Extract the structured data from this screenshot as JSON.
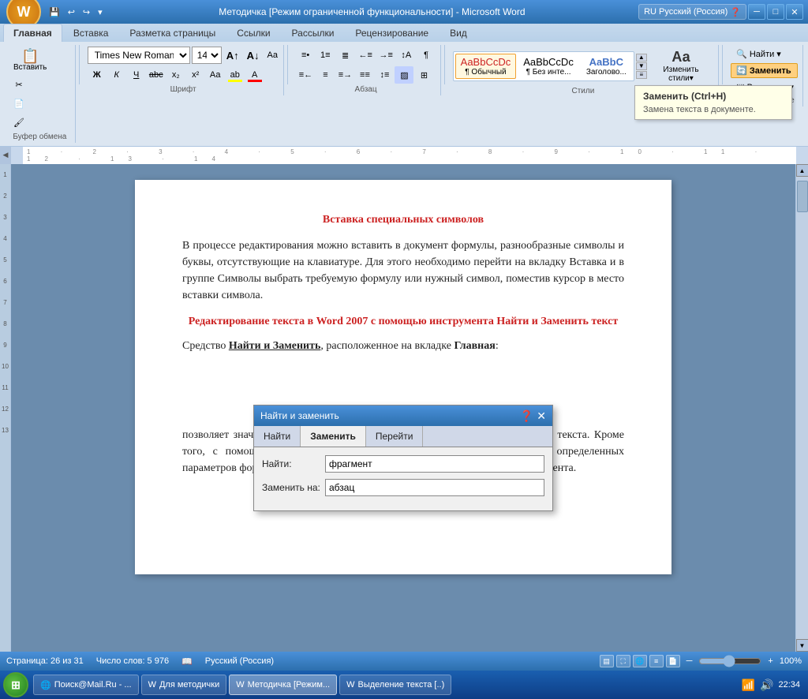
{
  "window": {
    "title": "Методичка [Режим ограниченной функциональности] - Microsoft Word",
    "lang_indicator": "RU Русский (Россия)"
  },
  "ribbon": {
    "tabs": [
      "Главная",
      "Вставка",
      "Разметка страницы",
      "Ссылки",
      "Рассылки",
      "Рецензирование",
      "Вид"
    ],
    "active_tab": "Главная",
    "paste_label": "Вставить",
    "clipboard_label": "Буфер обмена",
    "font_name": "Times New Roman",
    "font_size": "14",
    "font_group_label": "Шрифт",
    "paragraph_group_label": "Абзац",
    "styles_group_label": "Стили",
    "editing_group_label": "Редактирование",
    "find_label": "Найти",
    "replace_label": "Заменить",
    "select_label": "Выделить",
    "change_styles_label": "Изменить стили▾",
    "styles": [
      {
        "name": "Обычный",
        "preview": "AaBbCcDc",
        "active": true
      },
      {
        "name": "¶ Без инте...",
        "preview": "AaBbCcDc",
        "active": false
      },
      {
        "name": "Заголово...",
        "preview": "AaBbC",
        "active": false
      }
    ]
  },
  "document": {
    "title": "Вставка специальных символов",
    "paragraph1": "В процессе редактирования можно вставить в документ формулы, разнообразные символы и буквы, отсутствующие на клавиатуре. Для этого необходимо перейти на вкладку Вставка и в группе Символы выбрать требуемую формулу или нужный символ, поместив курсор в место вставки символа.",
    "heading2": "Редактирование текста в Word 2007 с помощью инструмента Найти и Заменить текст",
    "paragraph2_start": "Средство ",
    "paragraph2_bold": "Найти и Заменить",
    "paragraph2_end": ", расположенное на вкладке ",
    "paragraph2_bold2": "Главная",
    "paragraph2_colon": ":",
    "paragraph3": " позволяет значительно ускорить процесс редактирования (правки) большого текста. Кроме того, с помощью этой команды можно осуществлять поиск и замену определенных параметров форматирования, специальных символов и других объектов документа."
  },
  "tooltip": {
    "title": "Заменить (Ctrl+H)",
    "description": "Замена текста в документе."
  },
  "find_dialog": {
    "title": "Найти и заменить",
    "tabs": [
      "Найти",
      "Заменить",
      "Перейти"
    ],
    "active_tab": "Заменить",
    "find_label": "Найти:",
    "find_value": "фрагмент",
    "replace_label": "Заменить на:",
    "replace_value": "абзац"
  },
  "status_bar": {
    "page_info": "Страница: 26 из 31",
    "word_count": "Число слов: 5 976",
    "language": "Русский (Россия)",
    "zoom": "100%"
  },
  "taskbar": {
    "start": "⊞",
    "items": [
      {
        "label": "Поиск@Mail.Ru - ...",
        "active": false
      },
      {
        "label": "Для методички",
        "active": false
      },
      {
        "label": "Методичка [Режим...",
        "active": true
      },
      {
        "label": "Выделение текста [..)",
        "active": false
      }
    ],
    "time": "22:34"
  }
}
